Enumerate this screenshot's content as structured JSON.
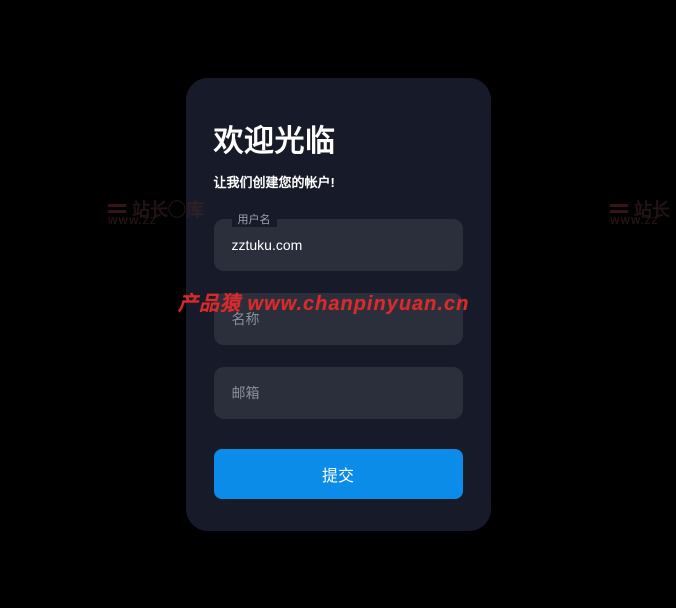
{
  "form": {
    "title": "欢迎光临",
    "subtitle": "让我们创建您的帐户!",
    "fields": {
      "username": {
        "label": "用户名",
        "value": "zztuku.com"
      },
      "name": {
        "placeholder": "名称"
      },
      "email": {
        "placeholder": "邮箱"
      }
    },
    "submit_label": "提交"
  },
  "watermarks": {
    "main": "产品猿  www.chanpinyuan.cn",
    "side_label": "站长",
    "side_suffix": "库",
    "side_url": "WWW.ZZ"
  }
}
